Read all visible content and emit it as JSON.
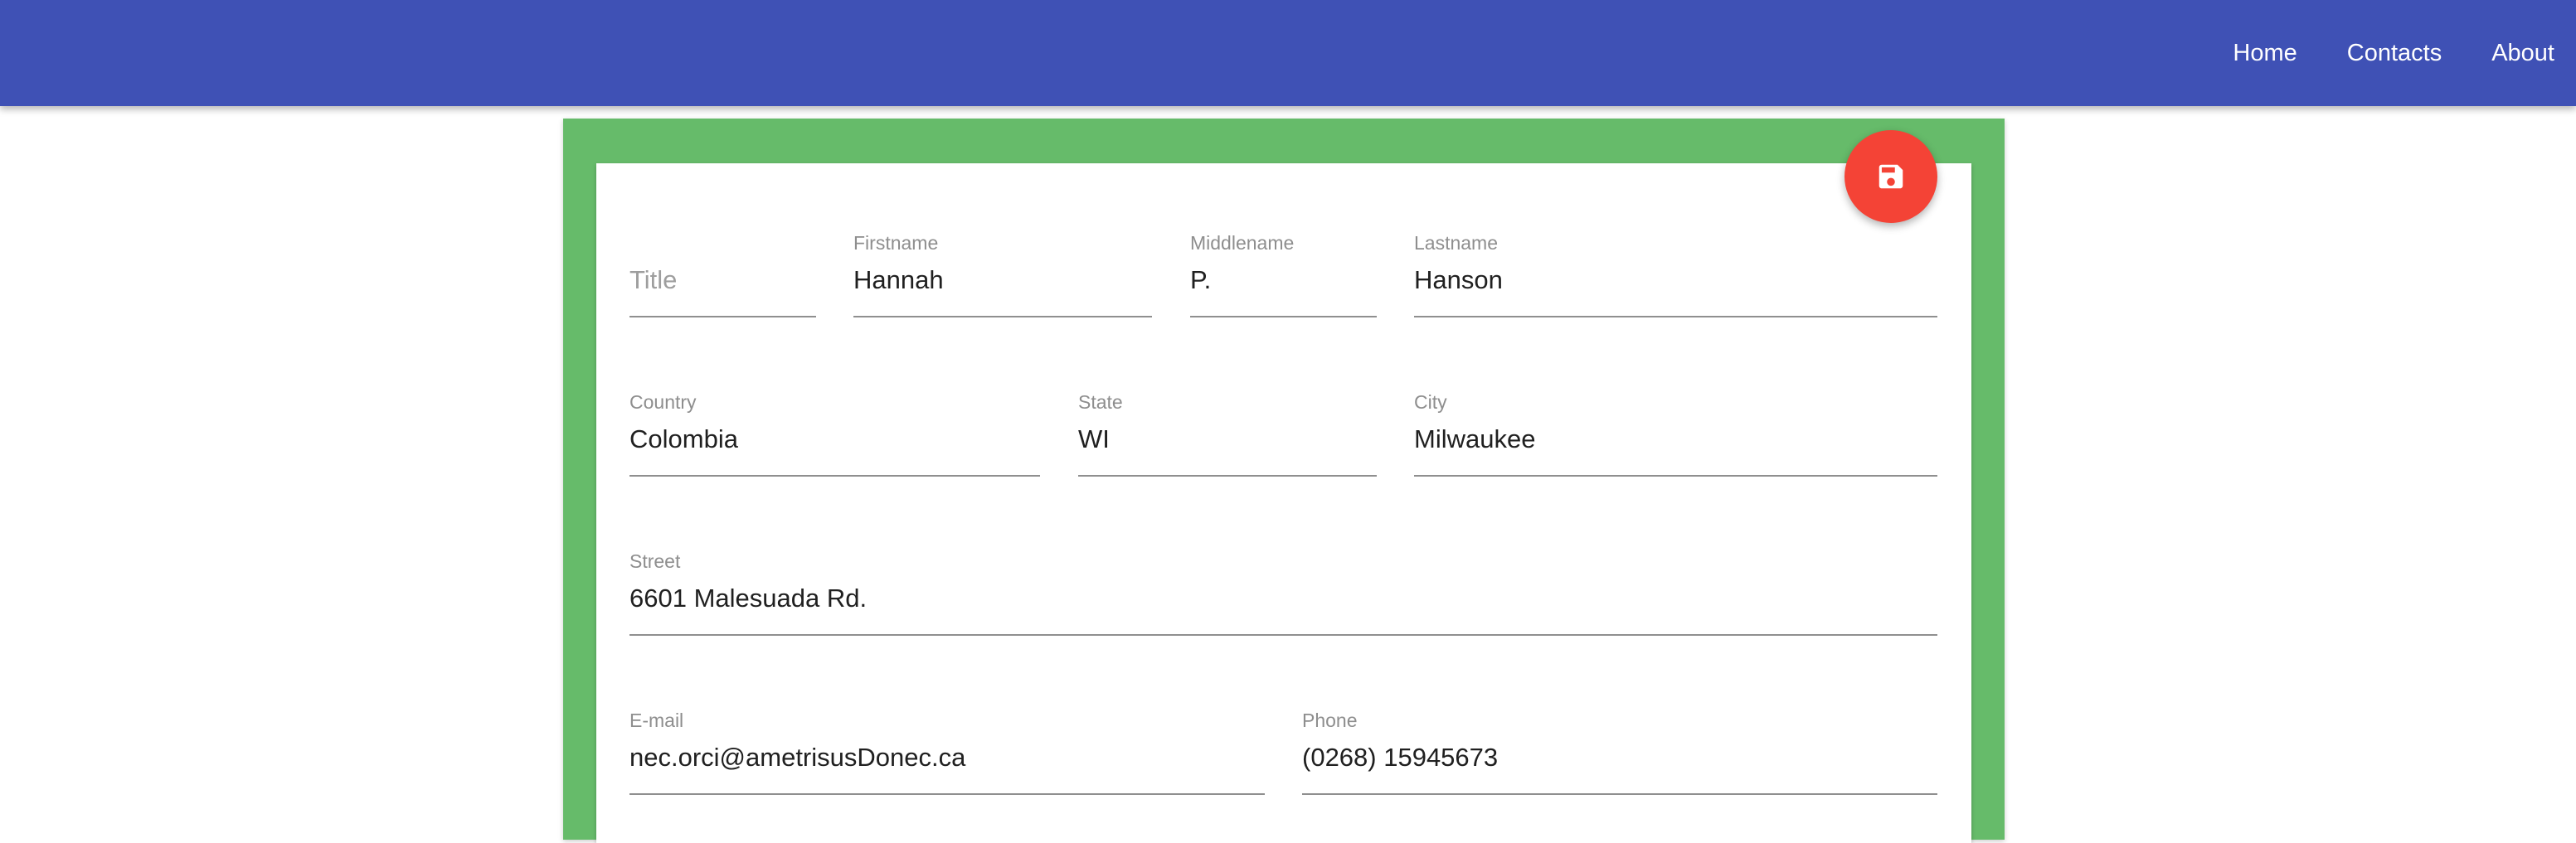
{
  "nav": {
    "home": "Home",
    "contacts": "Contacts",
    "about": "About",
    "bar_color": "#3f51b5"
  },
  "save_button": {
    "icon": "floppy-disk-icon",
    "color": "#f44336"
  },
  "panel_color": "#66bb6a",
  "form": {
    "title": {
      "label": "",
      "value": "",
      "placeholder": "Title"
    },
    "firstname": {
      "label": "Firstname",
      "value": "Hannah"
    },
    "middlename": {
      "label": "Middlename",
      "value": "P."
    },
    "lastname": {
      "label": "Lastname",
      "value": "Hanson"
    },
    "country": {
      "label": "Country",
      "value": "Colombia"
    },
    "state": {
      "label": "State",
      "value": "WI"
    },
    "city": {
      "label": "City",
      "value": "Milwaukee"
    },
    "street": {
      "label": "Street",
      "value": "6601 Malesuada Rd."
    },
    "email": {
      "label": "E-mail",
      "value": "nec.orci@ametrisusDonec.ca"
    },
    "phone": {
      "label": "Phone",
      "value": "(0268) 15945673"
    }
  }
}
